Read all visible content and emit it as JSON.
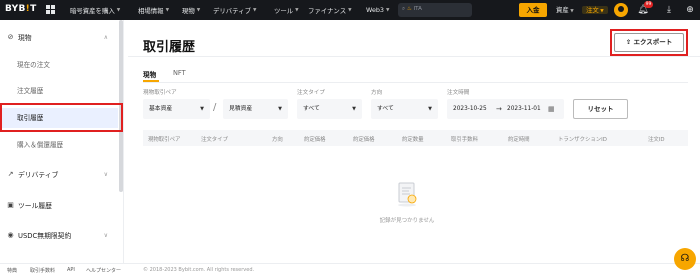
{
  "header": {
    "logo_text": "BYB",
    "logo_dot": "!",
    "logo_tail": "T",
    "nav": [
      {
        "label": "暗号資産を購入"
      },
      {
        "label": "相場情報"
      },
      {
        "label": "現物"
      },
      {
        "label": "デリバティブ"
      },
      {
        "label": "ツール"
      },
      {
        "label": "ファイナンス"
      },
      {
        "label": "Web3"
      }
    ],
    "search_placeholder": "ITA",
    "deposit_label": "入金",
    "assets_label": "資産",
    "orders_label": "注文",
    "notification_count": "99",
    "icons": [
      "grid-icon",
      "search-icon",
      "avatar",
      "bell-icon",
      "download-icon",
      "globe-icon"
    ]
  },
  "sidebar": {
    "groups": [
      {
        "label": "現物",
        "icon": "spot-icon",
        "expanded": true,
        "items": [
          "現在の注文",
          "注文履歴",
          "取引履歴",
          "購入＆償還履歴"
        ],
        "active_item": "取引履歴"
      },
      {
        "label": "デリバティブ",
        "icon": "derivatives-icon",
        "expanded": false
      },
      {
        "label": "ツール履歴",
        "icon": "tool-icon"
      },
      {
        "label": "USDC無期限契約",
        "icon": "usdc-icon",
        "expanded": false
      }
    ]
  },
  "main": {
    "title": "取引履歴",
    "export_label": "エクスポート",
    "tabs": [
      {
        "label": "現物",
        "active": true
      },
      {
        "label": "NFT",
        "active": false
      }
    ],
    "filters": {
      "pair_label": "現物取引ペア",
      "base_value": "基本資産",
      "quote_value": "見積資産",
      "order_type_label": "注文タイプ",
      "order_type_value": "すべて",
      "direction_label": "方向",
      "direction_value": "すべて",
      "time_label": "注文時間",
      "date_from": "2023-10-25",
      "date_to": "2023-11-01",
      "reset_label": "リセット"
    },
    "columns": [
      "現物取引ペア",
      "注文タイプ",
      "方向",
      "約定価格",
      "約定価格",
      "約定数量",
      "取引手数料",
      "約定時間",
      "トランザクションID",
      "注文ID"
    ],
    "empty_text": "記録が見つかりません"
  },
  "footer": {
    "links": [
      "特典",
      "取引手数料",
      "API",
      "ヘルプセンター"
    ],
    "copyright": "© 2018-2023 Bybit.com. All rights reserved."
  },
  "colors": {
    "accent": "#f7a600",
    "topbar": "#16181c",
    "highlight_box": "#e02020",
    "active_item_bg": "#eaf0ff"
  }
}
